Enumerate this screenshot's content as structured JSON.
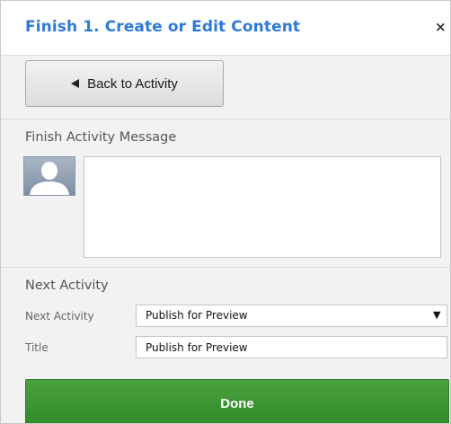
{
  "header": {
    "title": "Finish 1. Create or Edit Content",
    "close_symbol": "×",
    "close_icon": "close-icon"
  },
  "back_button": {
    "label": "Back to Activity",
    "icon": "triangle-left-icon"
  },
  "message_section": {
    "title": "Finish Activity Message",
    "avatar_icon": "user-avatar-icon",
    "message_value": ""
  },
  "next_activity": {
    "section_title": "Next Activity",
    "next_activity_label": "Next Activity",
    "next_activity_value": "Publish for Preview",
    "dropdown_icon": "triangle-down-icon",
    "title_label": "Title",
    "title_value": "Publish for Preview"
  },
  "done_button": {
    "label": "Done"
  },
  "colors": {
    "title_blue": "#2e7ad6",
    "done_green": "#3a9633",
    "panel_bg": "#f2f2f2"
  }
}
